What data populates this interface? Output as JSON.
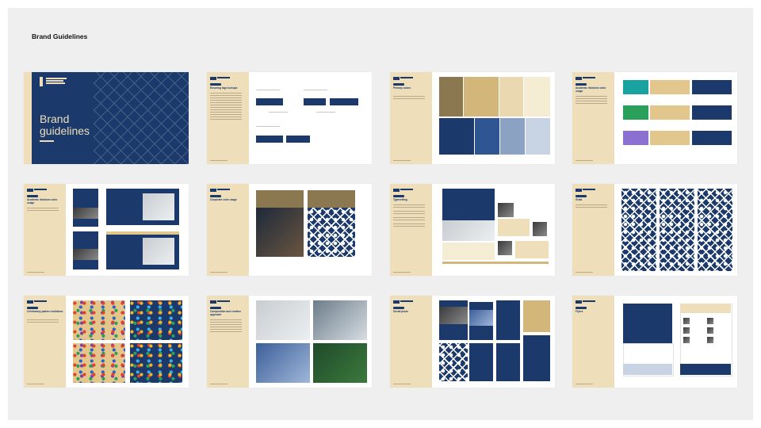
{
  "page": {
    "title": "Brand Guidelines"
  },
  "cover": {
    "title_line1": "Brand",
    "title_line2": "guidelines"
  },
  "colors": {
    "navy": "#1b3a6b",
    "sand": "#eedfba",
    "gold": "#c2a36b",
    "bronze": "#8b7750",
    "teal": "#19a3a0",
    "green": "#2aa05a",
    "purple": "#8b6fd1",
    "steel": "#5a7bb0",
    "mist": "#c8d4e3"
  },
  "slides": [
    {
      "name": "cover",
      "heading": ""
    },
    {
      "name": "logo-lockups",
      "heading": "Ensuring logo lockups"
    },
    {
      "name": "primary-colors",
      "heading": "Primary colors"
    },
    {
      "name": "academic-divisions",
      "heading": "Academic divisions color usage"
    },
    {
      "name": "academic-divisions-usage",
      "heading": "Academic divisions color usage"
    },
    {
      "name": "corporate-color-usage",
      "heading": "Corporate color usage"
    },
    {
      "name": "typesetting",
      "heading": "Typesetting"
    },
    {
      "name": "grids",
      "heading": "Grids"
    },
    {
      "name": "celebratory-pattern",
      "heading": "Celebratory pattern variations"
    },
    {
      "name": "composition",
      "heading": "Composition and creative approach"
    },
    {
      "name": "social-posts",
      "heading": "Social posts"
    },
    {
      "name": "flyers",
      "heading": "Flyers"
    }
  ]
}
